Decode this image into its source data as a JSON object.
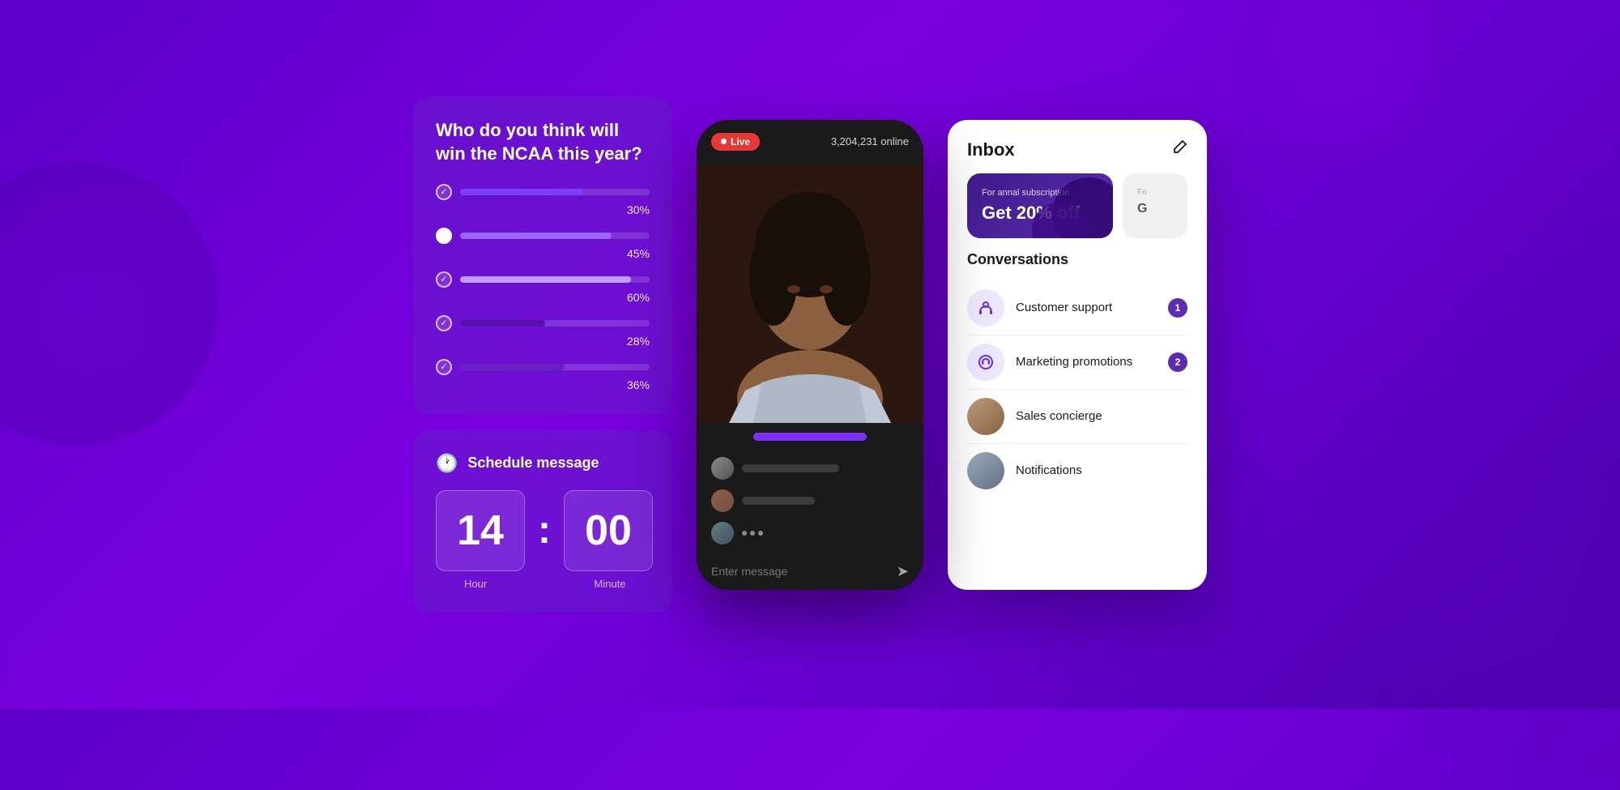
{
  "background": {
    "gradient_start": "#5a00c8",
    "gradient_end": "#4a00aa"
  },
  "poll_card": {
    "question": "Who do you think will win the NCAA this year?",
    "options": [
      {
        "id": 1,
        "checked": true,
        "bar_width": "65%",
        "bar_color": "#7b3ff7",
        "percent": "30%"
      },
      {
        "id": 2,
        "checked": false,
        "bar_width": "80%",
        "bar_color": "#9966ff",
        "percent": "45%"
      },
      {
        "id": 3,
        "checked": true,
        "bar_width": "90%",
        "bar_color": "#b090ff",
        "percent": "60%"
      },
      {
        "id": 4,
        "checked": true,
        "bar_width": "45%",
        "bar_color": "#6020c0",
        "percent": "28%"
      },
      {
        "id": 5,
        "checked": true,
        "bar_width": "55%",
        "bar_color": "#7030d0",
        "percent": "36%"
      }
    ]
  },
  "schedule_card": {
    "title": "Schedule message",
    "hour_value": "14",
    "minute_value": "00",
    "hour_label": "Hour",
    "minute_label": "Minute"
  },
  "phone": {
    "live_label": "Live",
    "online_count": "3,204,231 online",
    "input_placeholder": "Enter message"
  },
  "inbox": {
    "title": "Inbox",
    "promo_subtitle": "For annal subscription",
    "promo_main": "Get 20% off",
    "conversations_title": "Conversations",
    "items": [
      {
        "id": "support",
        "name": "Customer support",
        "badge": "1",
        "icon": "🏷️",
        "icon_type": "support"
      },
      {
        "id": "marketing",
        "name": "Marketing promotions",
        "badge": "2",
        "icon": "🎧",
        "icon_type": "marketing"
      },
      {
        "id": "sales",
        "name": "Sales concierge",
        "badge": "",
        "icon": "",
        "icon_type": "sales"
      },
      {
        "id": "notifications",
        "name": "Notifications",
        "badge": "",
        "icon": "",
        "icon_type": "notifications"
      }
    ]
  }
}
